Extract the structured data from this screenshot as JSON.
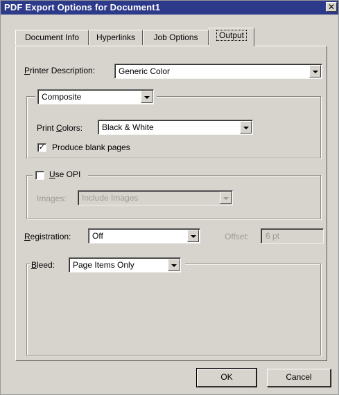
{
  "window": {
    "title": "PDF Export Options for Document1",
    "close_glyph": "✕"
  },
  "tabs": [
    {
      "label": "Document Info"
    },
    {
      "label": "Hyperlinks"
    },
    {
      "label": "Job Options"
    },
    {
      "label": "Output"
    }
  ],
  "printer_description": {
    "label_key": "P",
    "label_rest": "rinter Description:",
    "value": "Generic Color"
  },
  "output_mode": {
    "value": "Composite"
  },
  "print_colors": {
    "label_pre": "Print ",
    "label_key": "C",
    "label_rest": "olors:",
    "value": "Black & White"
  },
  "produce_blank_pages": {
    "label": "Produce blank pages",
    "checked": true,
    "mark": "✓"
  },
  "opi": {
    "label_key": "U",
    "label_rest": "se OPI",
    "checked": false
  },
  "images": {
    "label": "Images:",
    "value": "Include Images",
    "enabled": false
  },
  "registration": {
    "label_key": "R",
    "label_rest": "egistration:",
    "value": "Off"
  },
  "offset": {
    "label": "Offset:",
    "value": "6 pt",
    "enabled": false
  },
  "bleed": {
    "label_key": "B",
    "label_rest": "leed:",
    "value": "Page Items Only"
  },
  "buttons": {
    "ok": "OK",
    "cancel": "Cancel"
  }
}
